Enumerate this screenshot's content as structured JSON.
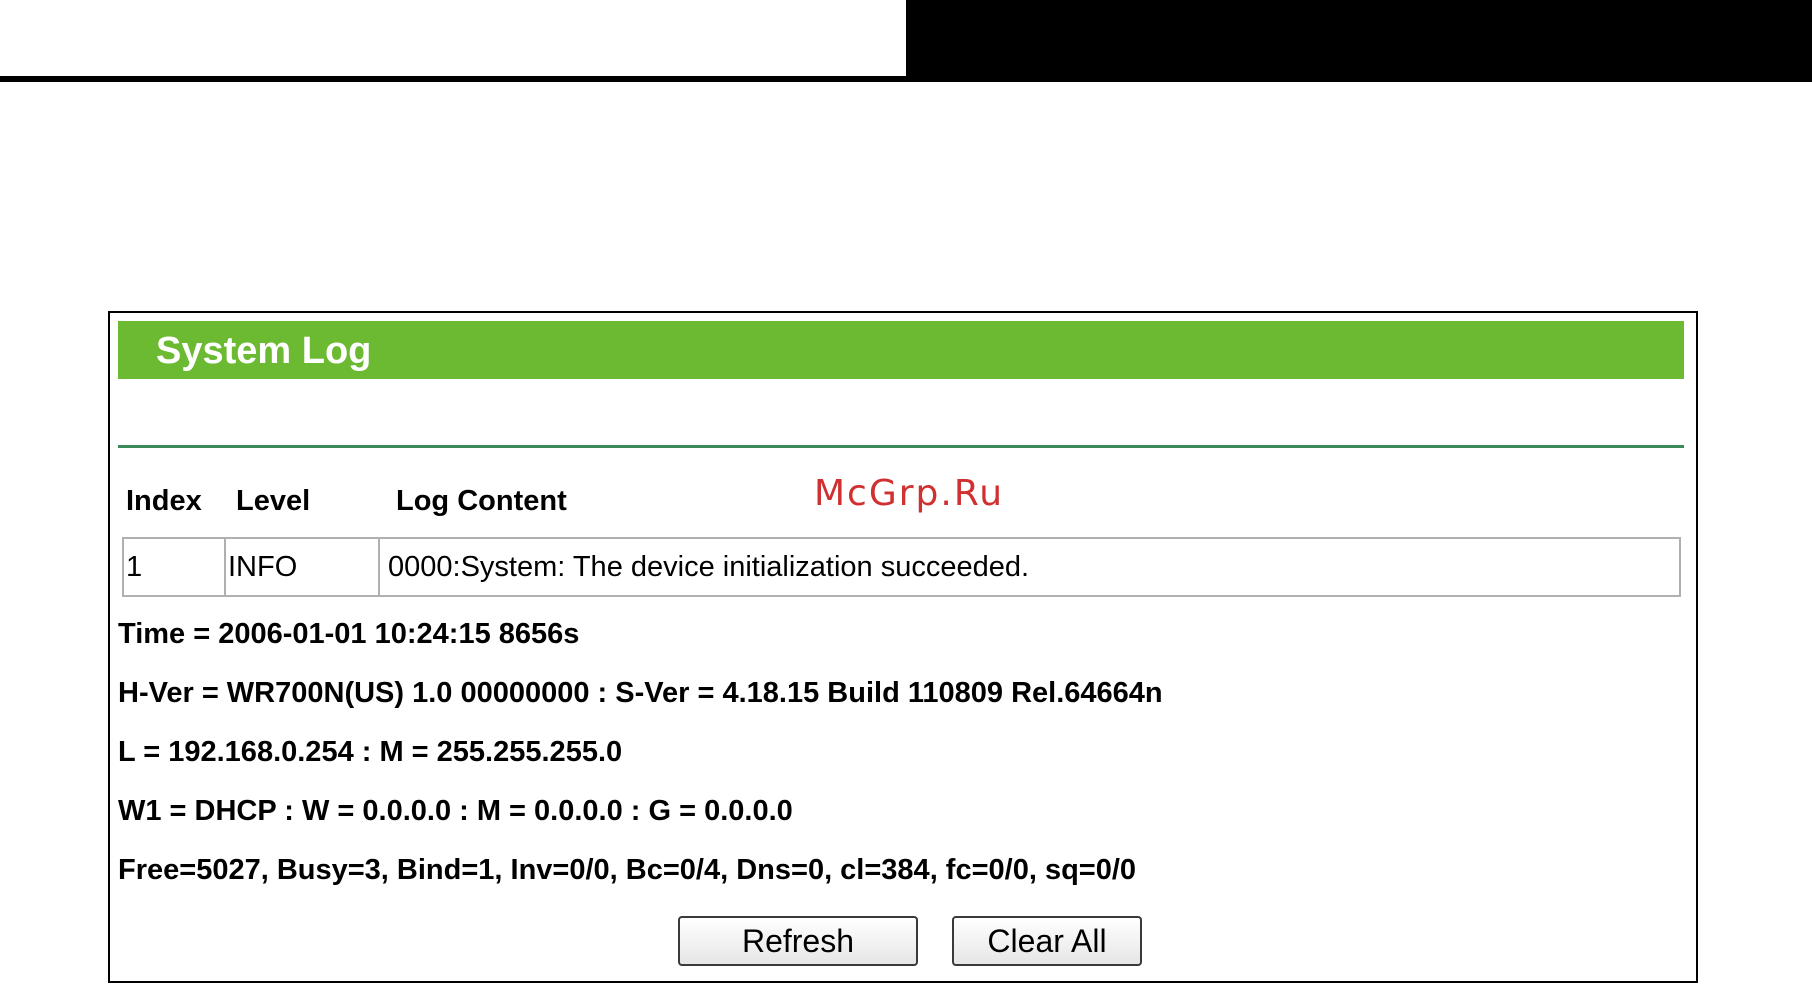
{
  "panel": {
    "title": "System Log"
  },
  "watermark": "McGrp.Ru",
  "table": {
    "headers": [
      "Index",
      "Level",
      "Log Content"
    ],
    "rows": [
      {
        "index": "1",
        "level": "INFO",
        "content": "0000:System: The device initialization succeeded."
      }
    ]
  },
  "info": {
    "time": "Time = 2006-01-01 10:24:15 8656s",
    "version": "H-Ver = WR700N(US) 1.0 00000000 : S-Ver = 4.18.15 Build 110809 Rel.64664n",
    "lan": "L = 192.168.0.254 : M = 255.255.255.0",
    "wan": "W1 = DHCP : W = 0.0.0.0 : M = 0.0.0.0 : G = 0.0.0.0",
    "stats": "Free=5027, Busy=3, Bind=1, Inv=0/0, Bc=0/4, Dns=0, cl=384, fc=0/0, sq=0/0"
  },
  "buttons": {
    "refresh": "Refresh",
    "clear_all": "Clear All"
  },
  "colors": {
    "title_bar": "#6cba31",
    "separator": "#3a8a5a"
  }
}
